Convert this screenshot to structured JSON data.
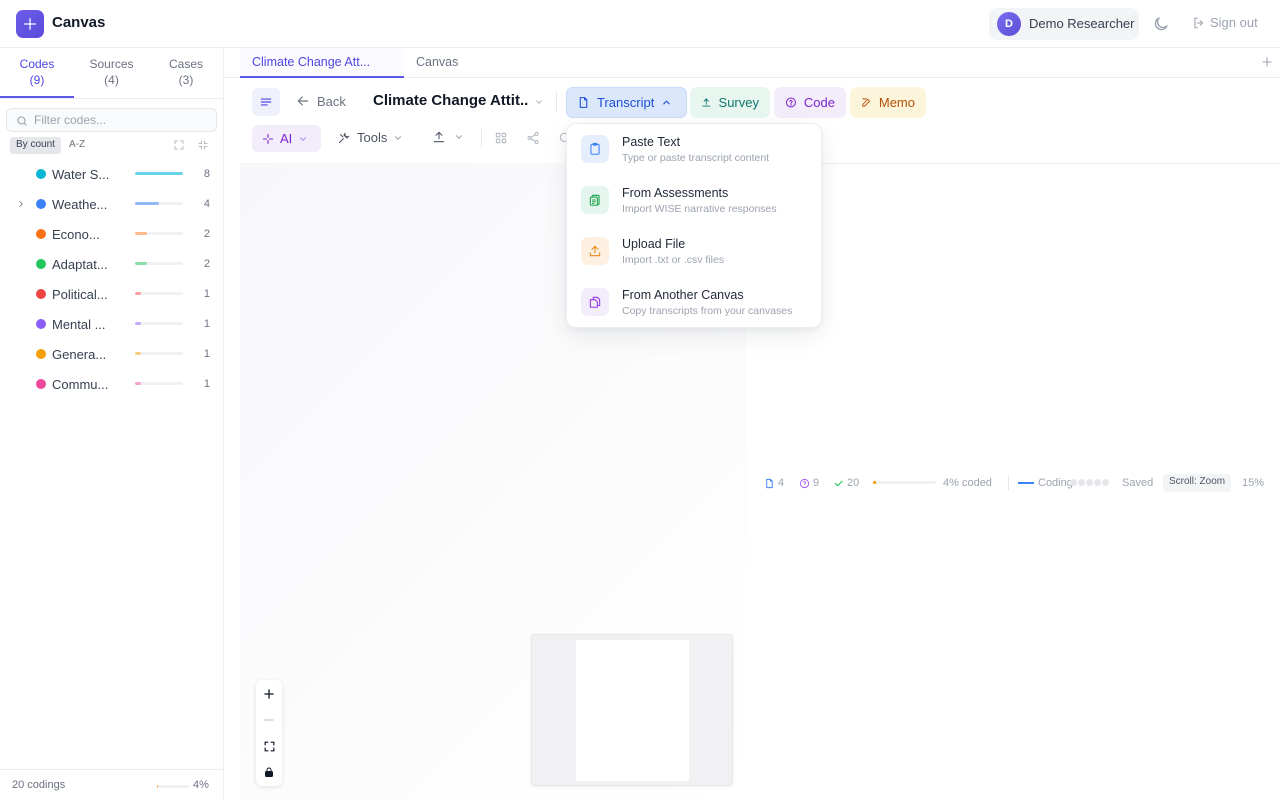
{
  "header": {
    "app_title": "Canvas",
    "logo_icon": "sparkle-icon",
    "user": {
      "initial": "D",
      "name": "Demo Researcher"
    },
    "theme_icon": "moon-icon",
    "signout_label": "Sign out"
  },
  "sidebar": {
    "tabs": [
      {
        "label": "Codes",
        "count": "(9)",
        "active": true
      },
      {
        "label": "Sources",
        "count": "(4)",
        "active": false
      },
      {
        "label": "Cases",
        "count": "(3)",
        "active": false
      }
    ],
    "filter_placeholder": "Filter codes...",
    "sort": {
      "by_count": "By count",
      "az": "A-Z"
    },
    "codes": [
      {
        "name": "Water S...",
        "count": "8",
        "color": "#06b6d4",
        "bar_color": "#67d4e8",
        "share": 1.0,
        "expandable": false
      },
      {
        "name": "Weathe...",
        "count": "4",
        "color": "#3b82f6",
        "bar_color": "#93b8f8",
        "share": 0.5,
        "expandable": true
      },
      {
        "name": "Econo...",
        "count": "2",
        "color": "#f97316",
        "bar_color": "#fdba8c",
        "share": 0.25,
        "expandable": false
      },
      {
        "name": "Adaptat...",
        "count": "2",
        "color": "#22c55e",
        "bar_color": "#86e0a8",
        "share": 0.25,
        "expandable": false
      },
      {
        "name": "Political...",
        "count": "1",
        "color": "#ef4444",
        "bar_color": "#f8a0a0",
        "share": 0.125,
        "expandable": false
      },
      {
        "name": "Mental ...",
        "count": "1",
        "color": "#8b5cf6",
        "bar_color": "#c2aaf9",
        "share": 0.125,
        "expandable": false
      },
      {
        "name": "Genera...",
        "count": "1",
        "color": "#f59e0b",
        "bar_color": "#f9cd80",
        "share": 0.125,
        "expandable": false
      },
      {
        "name": "Commu...",
        "count": "1",
        "color": "#ec4899",
        "bar_color": "#f5a3cb",
        "share": 0.125,
        "expandable": false
      }
    ],
    "footer": {
      "codings": "20 codings",
      "percent": "4%",
      "fraction": 0.04
    }
  },
  "doc_tabs": [
    {
      "label": "Climate Change Att...",
      "active": true
    },
    {
      "label": "Canvas",
      "active": false
    }
  ],
  "toolbar": {
    "back_label": "Back",
    "canvas_name": "Climate Change Attit...",
    "transcript_label": "Transcript",
    "survey_label": "Survey",
    "code_label": "Code",
    "memo_label": "Memo",
    "ai_label": "AI",
    "tools_label": "Tools"
  },
  "transcript_menu": [
    {
      "title": "Paste Text",
      "desc": "Type or paste transcript content",
      "icon": "clipboard-icon",
      "icon_bg": "#e6eefc",
      "icon_color": "#3b82f6"
    },
    {
      "title": "From Assessments",
      "desc": "Import WISE narrative responses",
      "icon": "clipboard-list-icon",
      "icon_bg": "#e3f5ec",
      "icon_color": "#16a34a"
    },
    {
      "title": "Upload File",
      "desc": "Import .txt or .csv files",
      "icon": "upload-icon",
      "icon_bg": "#fdf0e1",
      "icon_color": "#ea8a1a"
    },
    {
      "title": "From Another Canvas",
      "desc": "Copy transcripts from your canvases",
      "icon": "copy-icon",
      "icon_bg": "#f3ecfb",
      "icon_color": "#9333ea"
    }
  ],
  "status": {
    "sources": "4",
    "questions": "9",
    "codings": "20",
    "coded_fraction": 0.04,
    "coded_label": "4% coded",
    "mode_label": "Coding",
    "saved_label": "Saved",
    "scroll_label": "Scroll: Zoom",
    "zoom_label": "15%"
  }
}
